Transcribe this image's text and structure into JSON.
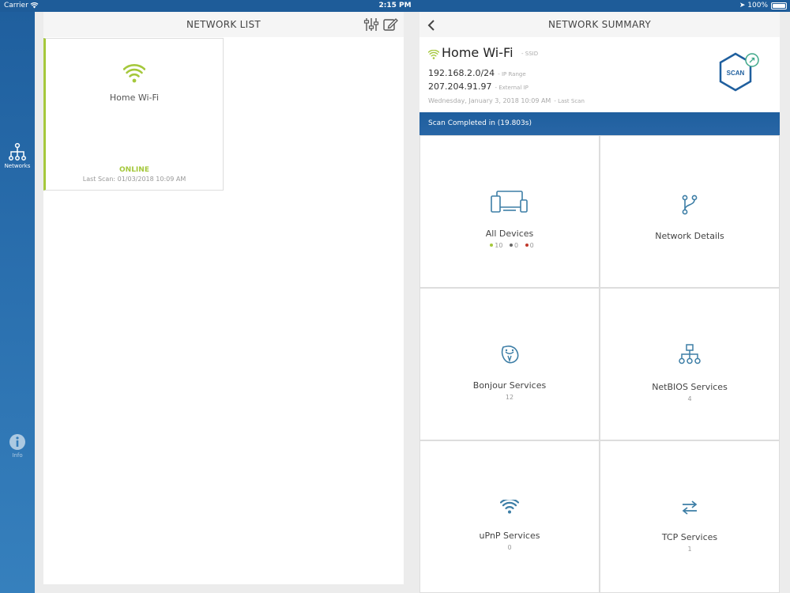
{
  "status_bar": {
    "carrier": "Carrier",
    "time": "2:15 PM",
    "battery": "100%"
  },
  "sidebar": {
    "items": [
      {
        "label": "Networks",
        "icon": "network-icon",
        "active": true
      },
      {
        "label": "Info",
        "icon": "info-icon",
        "active": false
      }
    ]
  },
  "network_list": {
    "title": "NETWORK LIST",
    "networks": [
      {
        "name": "Home Wi-Fi",
        "status": "ONLINE",
        "last_scan": "Last Scan: 01/03/2018 10:09 AM"
      }
    ]
  },
  "summary": {
    "title": "NETWORK SUMMARY",
    "ssid": "Home Wi-Fi",
    "ssid_label": "- SSID",
    "ip_range": "192.168.2.0/24",
    "ip_range_label": "- IP Range",
    "external_ip": "207.204.91.97",
    "external_ip_label": "- External IP",
    "last_scan": "Wednesday, January 3, 2018 10:09 AM",
    "last_scan_label": "- Last Scan",
    "scan_button": "SCAN",
    "scan_banner": "Scan Completed in (19.803s)"
  },
  "tiles": {
    "all_devices": {
      "label": "All Devices",
      "counts": [
        "10",
        "0",
        "0"
      ]
    },
    "network_details": {
      "label": "Network Details"
    },
    "bonjour": {
      "label": "Bonjour Services",
      "count": "12"
    },
    "netbios": {
      "label": "NetBIOS Services",
      "count": "4"
    },
    "upnp": {
      "label": "uPnP Services",
      "count": "0"
    },
    "tcp": {
      "label": "TCP Services",
      "count": "1"
    }
  },
  "colors": {
    "brand_blue": "#1f5f9e",
    "accent_green": "#a5c83c",
    "icon_teal": "#3d7ea6",
    "dot_green": "#a5c83c",
    "dot_gray": "#666666",
    "dot_red": "#c0392b"
  }
}
